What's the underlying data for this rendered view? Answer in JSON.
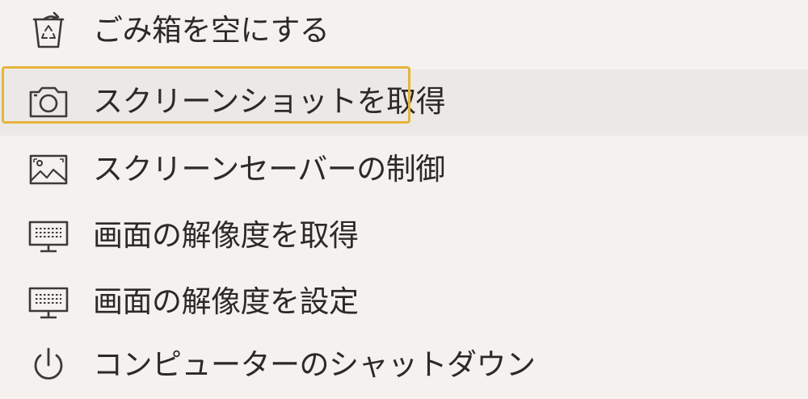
{
  "menu": {
    "items": [
      {
        "label": "ごみ箱を空にする",
        "icon": "recycle-bin-icon"
      },
      {
        "label": "スクリーンショットを取得",
        "icon": "camera-icon"
      },
      {
        "label": "スクリーンセーバーの制御",
        "icon": "picture-icon"
      },
      {
        "label": "画面の解像度を取得",
        "icon": "monitor-icon"
      },
      {
        "label": "画面の解像度を設定",
        "icon": "monitor-icon"
      },
      {
        "label": "コンピューターのシャットダウン",
        "icon": "power-icon"
      }
    ],
    "selected_index": 1
  },
  "colors": {
    "background": "#f4f1ef",
    "selected_background": "#ebe8e6",
    "focus_border": "#e7b43a",
    "text": "#2a2a2a",
    "icon_stroke": "#3a3a3a"
  }
}
